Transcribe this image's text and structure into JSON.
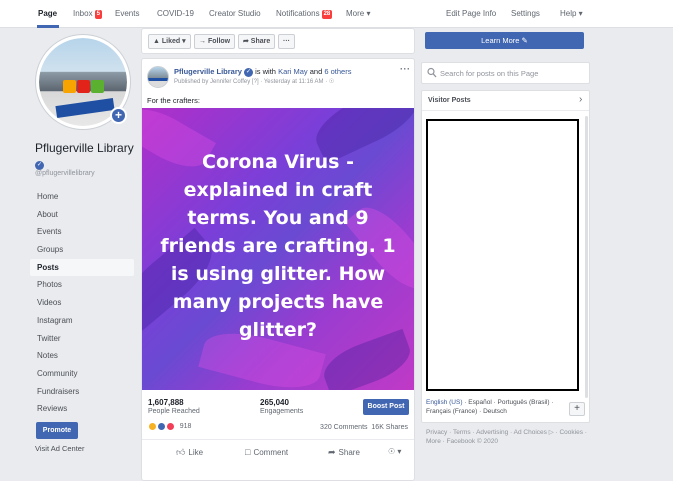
{
  "topnav": {
    "items": [
      "Page",
      "Inbox",
      "Events",
      "COVID-19",
      "Creator Studio",
      "Notifications",
      "More ▾"
    ],
    "inbox_badge": "5",
    "notifications_badge": "28",
    "right_items": [
      "Edit Page Info",
      "Settings",
      "Help ▾"
    ]
  },
  "page": {
    "name": "Pflugerville Library",
    "handle": "@pflugervillelibrary",
    "verified_icon": "check-badge-icon"
  },
  "leftnav": {
    "items": [
      "Home",
      "About",
      "Events",
      "Groups",
      "Posts",
      "Photos",
      "Videos",
      "Instagram",
      "Twitter",
      "Notes",
      "Community",
      "Fundraisers",
      "Reviews"
    ],
    "active": "Posts",
    "promote_label": "Promote",
    "ad_center_label": "Visit Ad Center"
  },
  "action_bar": {
    "liked": "▲ Liked ▾",
    "follow": "→ Follow",
    "share": "➦ Share",
    "more": "···"
  },
  "post": {
    "author": "Pflugerville Library",
    "with_text": "is with",
    "tagged": "Kari May",
    "and_text": "and",
    "others": "6 others",
    "published_by": "Published by Jennifer Coffey [?] · Yesterday at 11:16 AM ·",
    "text": "For the crafters:",
    "image_text": "Corona Virus - explained in craft terms. You and 9 friends are crafting. 1 is using glitter. How many projects have glitter?",
    "people_reached": "1,607,888",
    "people_reached_label": "People Reached",
    "engagements": "265,040",
    "engagements_label": "Engagements",
    "boost_label": "Boost Post",
    "reaction_count": "918",
    "comments": "320 Comments",
    "shares": "16K Shares",
    "actions": {
      "like": "Like",
      "comment": "Comment",
      "share": "Share"
    }
  },
  "right": {
    "learn_more": "Learn More ✎",
    "search_placeholder": "Search for posts on this Page",
    "visitor_posts_title": "Visitor Posts",
    "languages_selected": "English (US)",
    "languages_others": "· Español · Português (Brasil) · Français (France) · Deutsch",
    "footer": "Privacy · Terms · Advertising · Ad Choices ▷ · Cookies · More · Facebook © 2020"
  },
  "colors": {
    "brand_blue": "#4267b2",
    "link_blue": "#385898",
    "badge_red": "#fa3e3e",
    "image_purple": "#7a3fd8",
    "image_pink": "#c03ac6"
  }
}
